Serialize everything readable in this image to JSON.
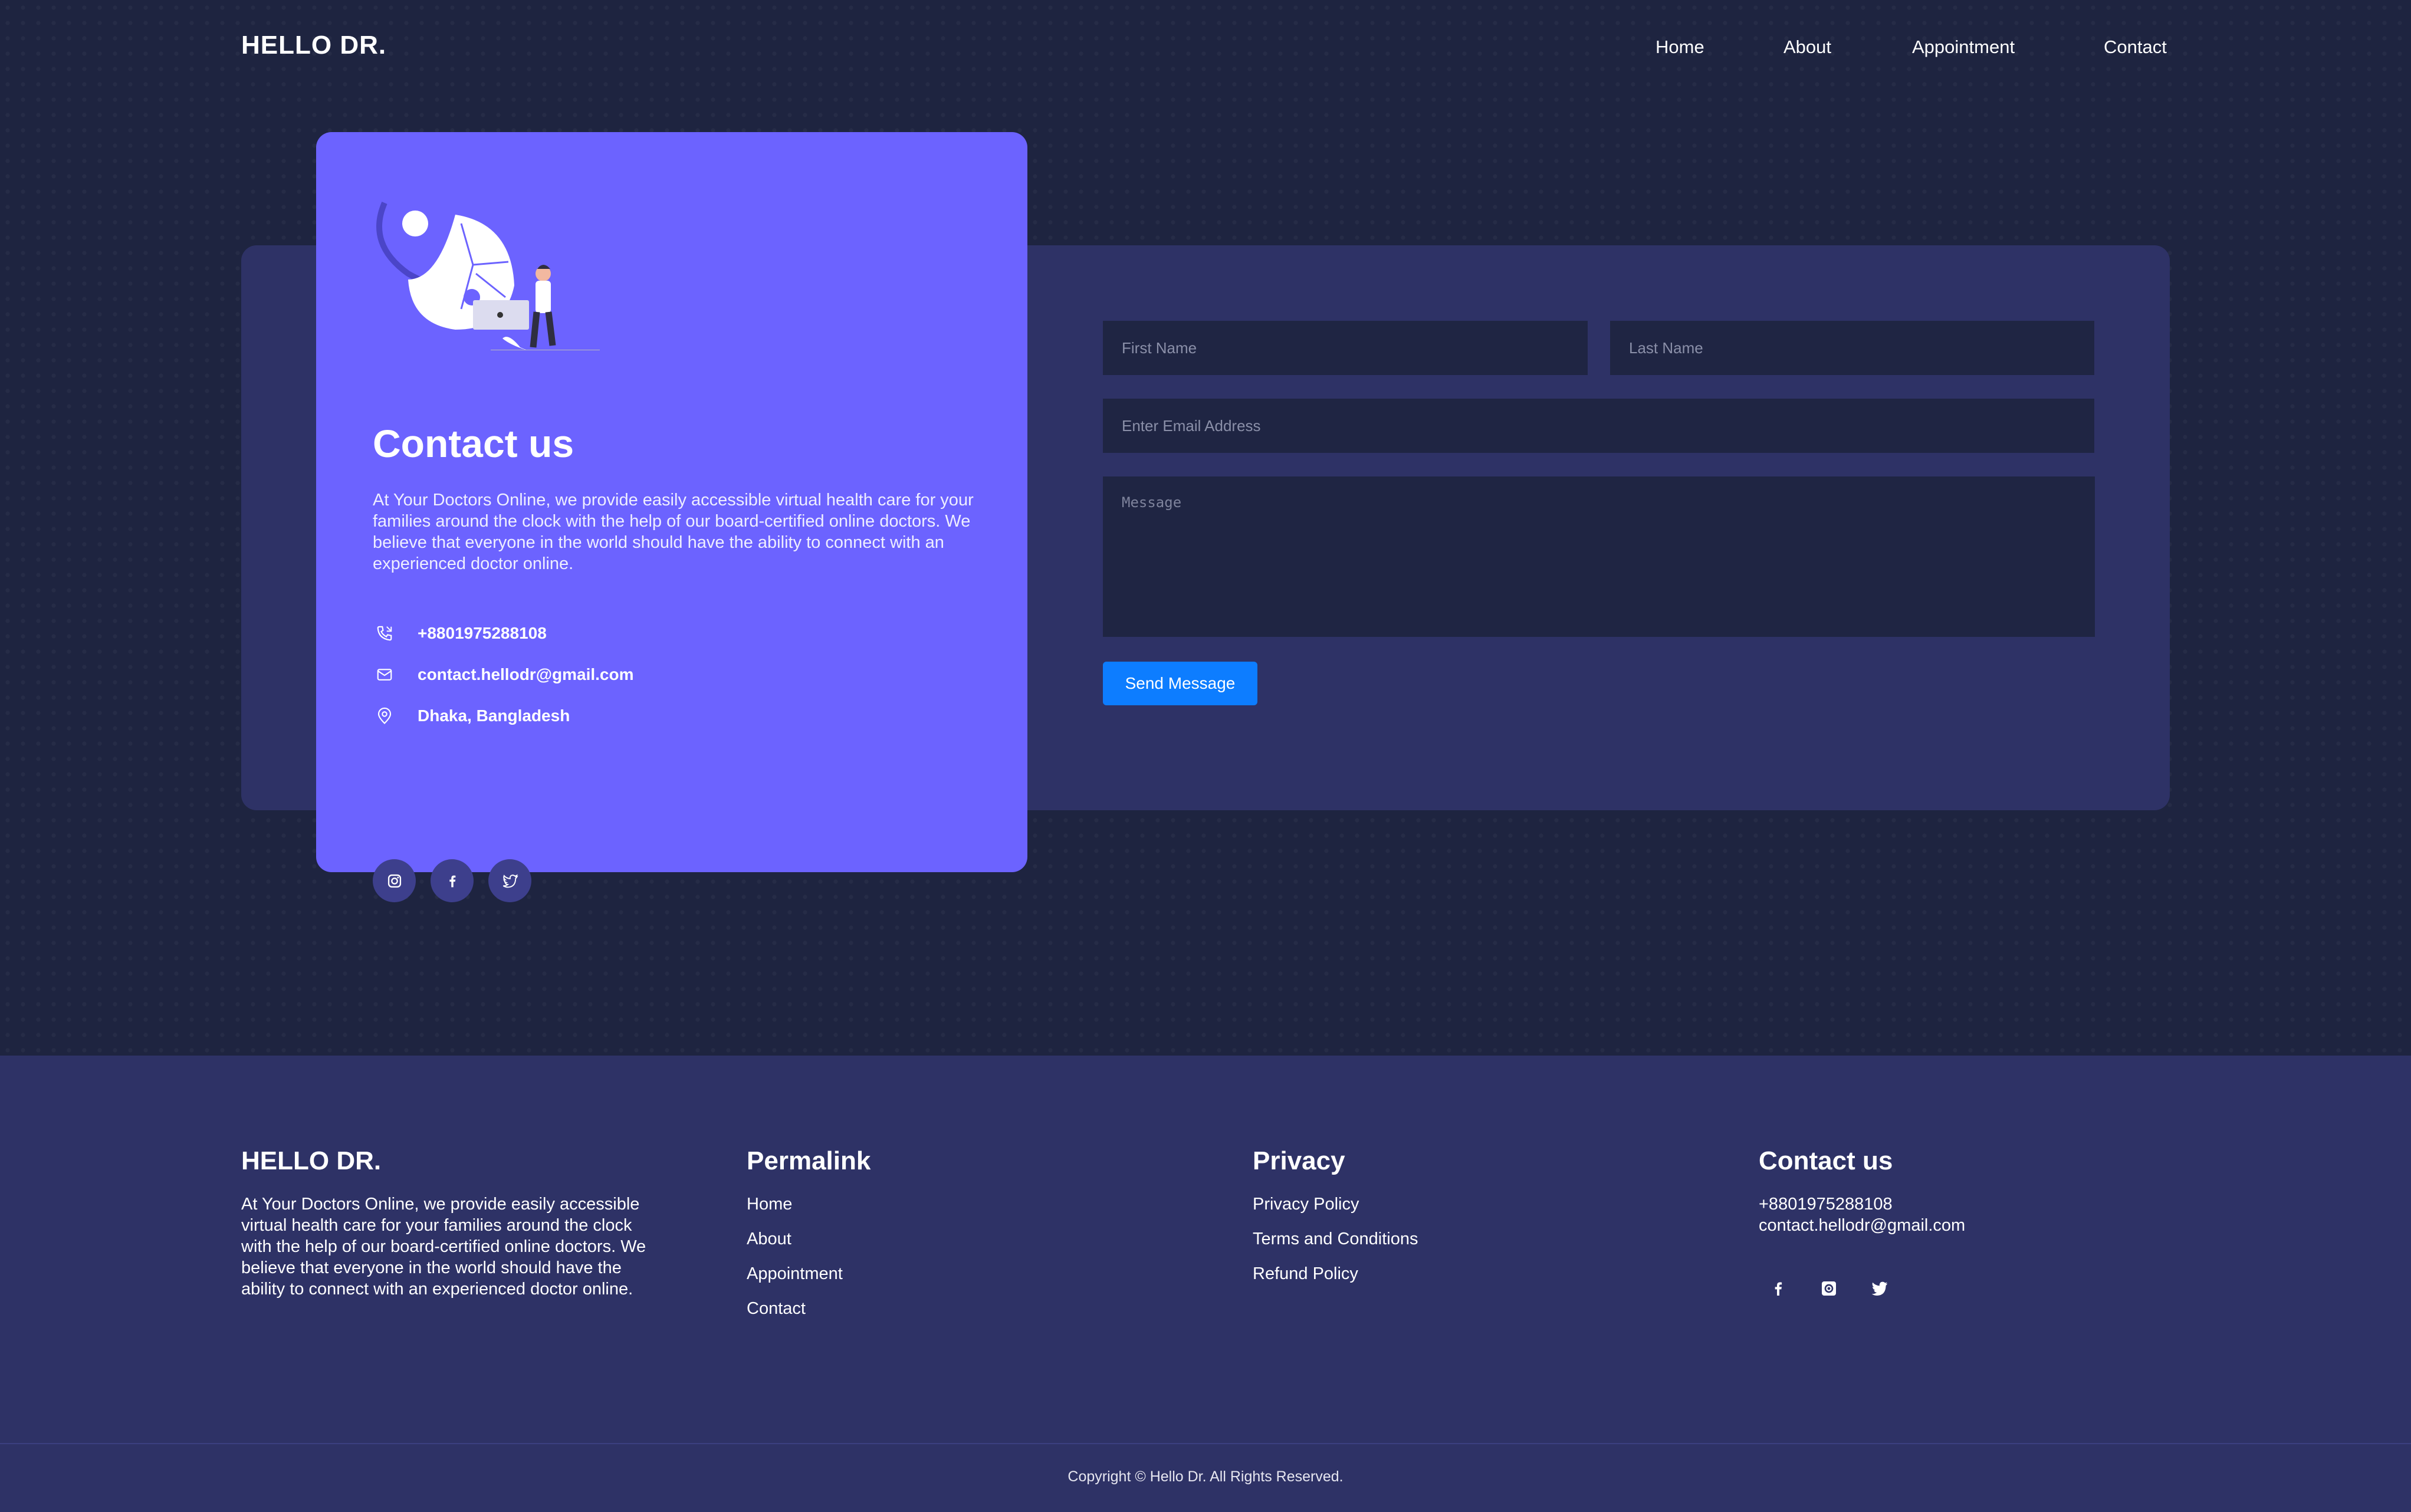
{
  "brand": "HELLO DR.",
  "nav": [
    "Home",
    "About",
    "Appointment",
    "Contact"
  ],
  "contact_card": {
    "title": "Contact us",
    "description": "At Your Doctors Online, we provide easily accessible virtual health care for your families around the clock with the help of our board-certified online doctors. We believe that everyone in the world should have the ability to connect with an experienced doctor online.",
    "phone": "+8801975288108",
    "email": "contact.hellodr@gmail.com",
    "location": "Dhaka, Bangladesh",
    "socials": [
      "instagram-icon",
      "facebook-icon",
      "twitter-icon"
    ]
  },
  "form": {
    "first_name_placeholder": "First Name",
    "last_name_placeholder": "Last Name",
    "email_placeholder": "Enter Email Address",
    "message_placeholder": "Message",
    "send_label": "Send Message"
  },
  "footer": {
    "brand": "HELLO DR.",
    "description": "At Your Doctors Online, we provide easily accessible virtual health care for your families around the clock with the help of our board-certified online doctors. We believe that everyone in the world should have the ability to connect with an experienced doctor online.",
    "permalink": {
      "title": "Permalink",
      "links": [
        "Home",
        "About",
        "Appointment",
        "Contact"
      ]
    },
    "privacy": {
      "title": "Privacy",
      "links": [
        "Privacy Policy",
        "Terms and Conditions",
        "Refund Policy"
      ]
    },
    "contact": {
      "title": "Contact us",
      "phone": "+8801975288108",
      "email": "contact.hellodr@gmail.com",
      "socials": [
        "facebook-icon",
        "instagram-icon",
        "twitter-icon"
      ]
    },
    "copyright": "Copyright © Hello Dr. All Rights Reserved."
  },
  "colors": {
    "background": "#1e2440",
    "panel": "#2e3266",
    "card": "#6c63ff",
    "input": "#1f2543",
    "button": "#0d7dff",
    "social_bubble": "#3d3f8c"
  }
}
